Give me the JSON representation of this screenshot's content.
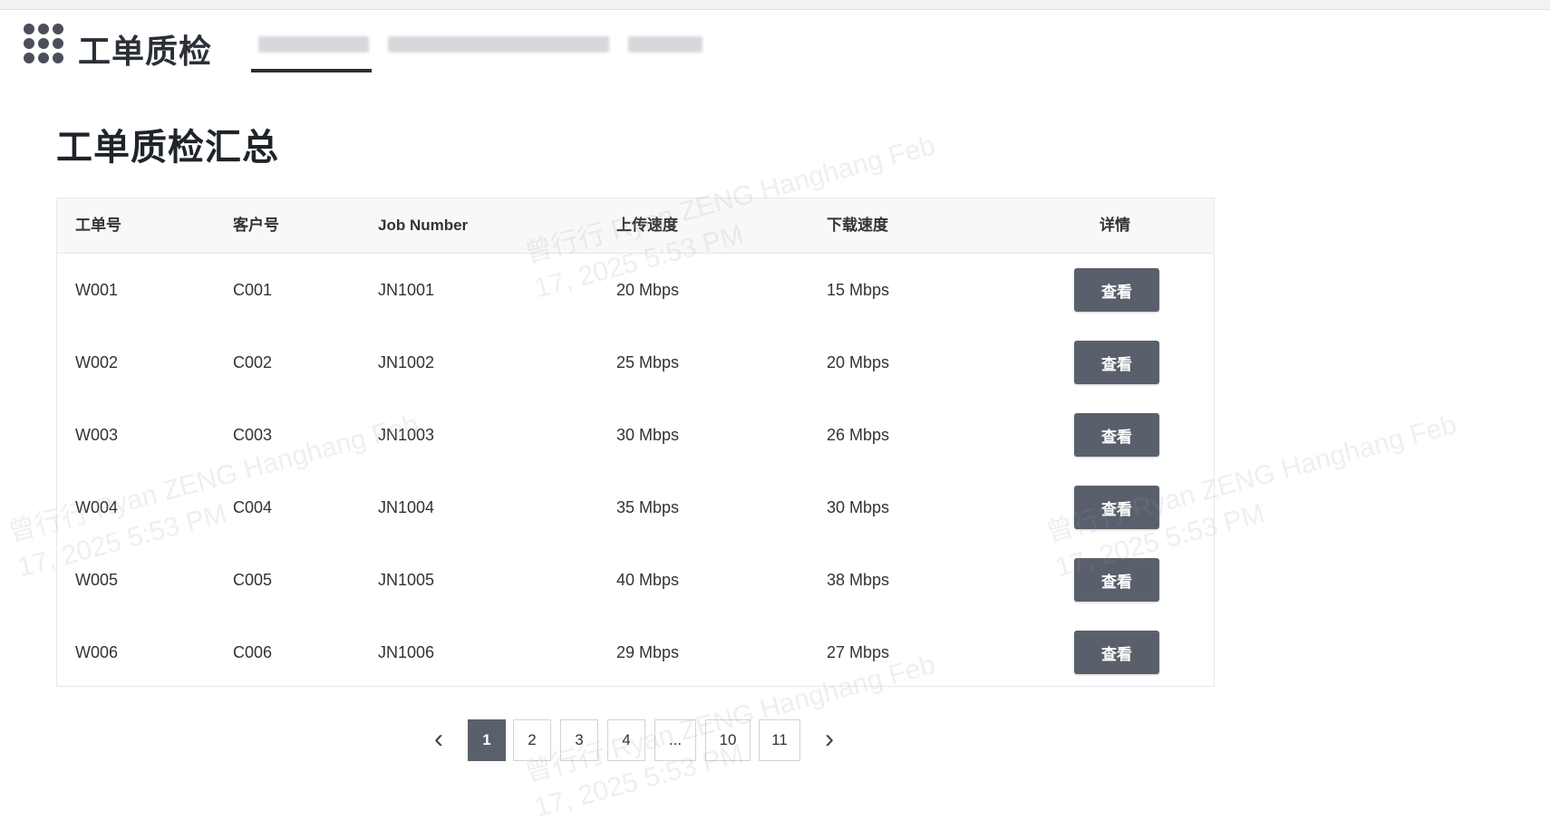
{
  "app": {
    "title": "工单质检",
    "logo_icon": "grid-dots-icon",
    "nav_tabs": [
      {
        "label": "",
        "active": true
      },
      {
        "label": "",
        "active": false
      },
      {
        "label": "",
        "active": false
      }
    ]
  },
  "page": {
    "title": "工单质检汇总"
  },
  "table": {
    "columns": [
      "工单号",
      "客户号",
      "Job Number",
      "上传速度",
      "下载速度",
      "详情"
    ],
    "rows": [
      {
        "order": "W001",
        "customer": "C001",
        "job": "JN1001",
        "upload": "20 Mbps",
        "download": "15 Mbps",
        "action": "查看"
      },
      {
        "order": "W002",
        "customer": "C002",
        "job": "JN1002",
        "upload": "25 Mbps",
        "download": "20 Mbps",
        "action": "查看"
      },
      {
        "order": "W003",
        "customer": "C003",
        "job": "JN1003",
        "upload": "30 Mbps",
        "download": "26 Mbps",
        "action": "查看"
      },
      {
        "order": "W004",
        "customer": "C004",
        "job": "JN1004",
        "upload": "35 Mbps",
        "download": "30 Mbps",
        "action": "查看"
      },
      {
        "order": "W005",
        "customer": "C005",
        "job": "JN1005",
        "upload": "40 Mbps",
        "download": "38 Mbps",
        "action": "查看"
      },
      {
        "order": "W006",
        "customer": "C006",
        "job": "JN1006",
        "upload": "29 Mbps",
        "download": "27 Mbps",
        "action": "查看"
      }
    ]
  },
  "pagination": {
    "prev": "‹",
    "next": "›",
    "pages": [
      "1",
      "2",
      "3",
      "4",
      "...",
      "10",
      "11"
    ],
    "current": "1"
  },
  "watermark": {
    "line1": "曾行行 Ryan ZENG Hanghang Feb",
    "line2": "17, 2025 5:53 PM"
  },
  "colors": {
    "accent": "#5a606b",
    "header_bg": "#f8f8f9",
    "border": "#e6e8eb"
  }
}
